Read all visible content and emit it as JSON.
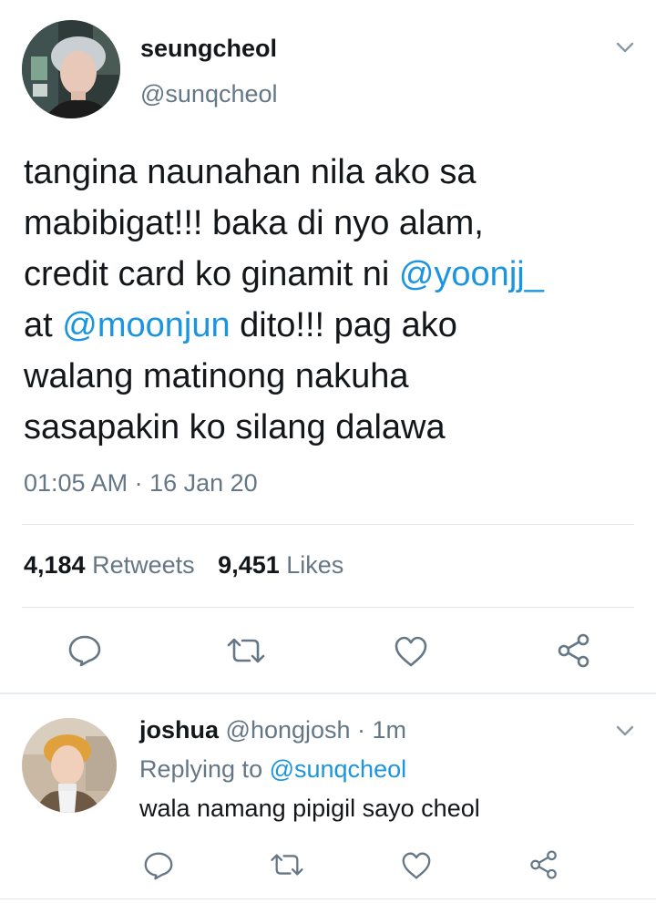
{
  "tweet": {
    "author_name": "seungcheol",
    "author_handle": "@sunqcheol",
    "text": {
      "line1": "tangina naunahan nila ako sa",
      "line2": "mabibigat!!! baka di nyo alam,",
      "line3_a": "credit card ko ginamit ni ",
      "line3_mention": "@yoonjj_",
      "line4_a": "at ",
      "line4_mention": "@moonjun",
      "line4_b": " dito!!! pag ako",
      "line5": "walang matinong nakuha",
      "line6": "sasapakin ko silang dalawa"
    },
    "timestamp": "01:05 AM · 16 Jan 20",
    "retweets_count": "4,184",
    "retweets_label": "Retweets",
    "likes_count": "9,451",
    "likes_label": "Likes"
  },
  "reply": {
    "author_name": "joshua",
    "author_handle": "@hongjosh",
    "time": " · 1m",
    "replying_prefix": "Replying to ",
    "replying_to": "@sunqcheol",
    "text": "wala namang pipigil sayo cheol"
  },
  "icons": {
    "reply": "reply-icon",
    "retweet": "retweet-icon",
    "like": "heart-icon",
    "share": "share-icon",
    "menu": "chevron-down-icon"
  },
  "colors": {
    "text": "#14171a",
    "secondary": "#657786",
    "link": "#1b95e0",
    "divider": "#e1e8ed"
  }
}
